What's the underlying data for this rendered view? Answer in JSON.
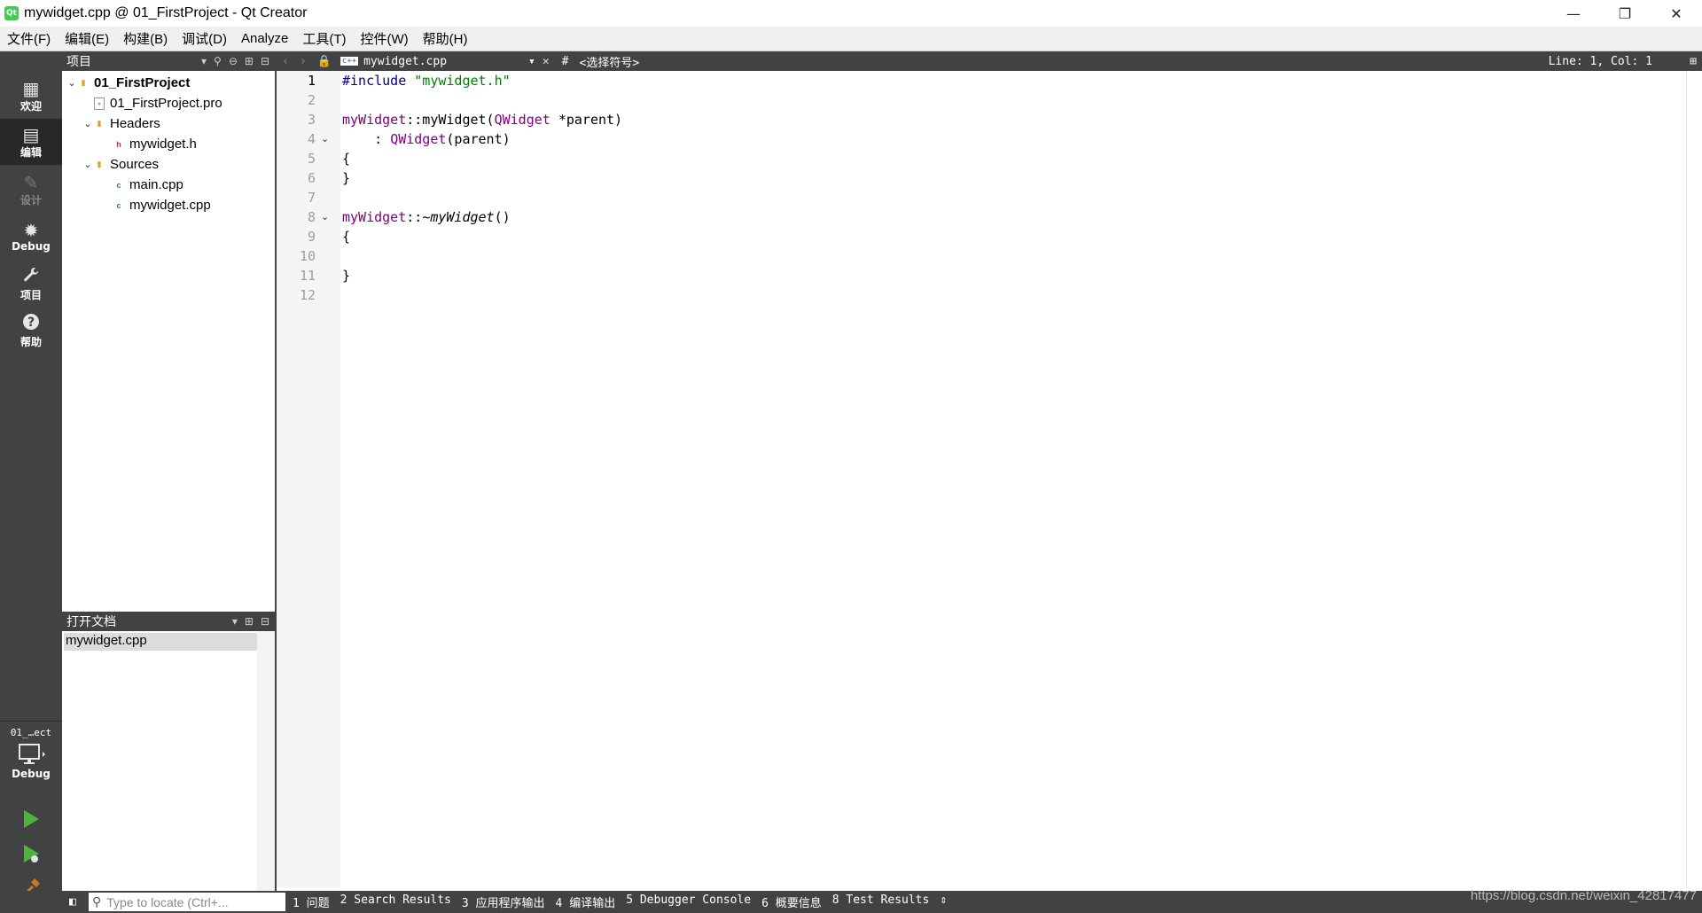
{
  "window": {
    "title": "mywidget.cpp @ 01_FirstProject - Qt Creator",
    "app_icon_text": "Qt",
    "minimize": "—",
    "maximize": "❐",
    "close": "✕"
  },
  "menu": [
    "文件(F)",
    "编辑(E)",
    "构建(B)",
    "调试(D)",
    "Analyze",
    "工具(T)",
    "控件(W)",
    "帮助(H)"
  ],
  "modes": [
    {
      "label": "欢迎",
      "icon": "grid-icon",
      "glyph": "▦",
      "state": "normal"
    },
    {
      "label": "编辑",
      "icon": "edit-icon",
      "glyph": "▤",
      "state": "active"
    },
    {
      "label": "设计",
      "icon": "pencil-icon",
      "glyph": "✎",
      "state": "disabled"
    },
    {
      "label": "Debug",
      "icon": "bug-icon",
      "glyph": "✹",
      "state": "normal"
    },
    {
      "label": "项目",
      "icon": "wrench-icon",
      "glyph": "🔧",
      "state": "normal"
    },
    {
      "label": "帮助",
      "icon": "help-icon",
      "glyph": "?",
      "state": "normal"
    }
  ],
  "kit": {
    "project": "01_…ect",
    "config": "Debug"
  },
  "project_panel": {
    "title": "项目",
    "tree": [
      {
        "label": "01_FirstProject",
        "level": 0,
        "expanded": true,
        "bold": true,
        "icon": "project-folder-icon"
      },
      {
        "label": "01_FirstProject.pro",
        "level": 1,
        "icon": "pro-file-icon"
      },
      {
        "label": "Headers",
        "level": 1,
        "expanded": true,
        "icon": "headers-folder-icon"
      },
      {
        "label": "mywidget.h",
        "level": 2,
        "icon": "header-file-icon"
      },
      {
        "label": "Sources",
        "level": 1,
        "expanded": true,
        "icon": "sources-folder-icon"
      },
      {
        "label": "main.cpp",
        "level": 2,
        "icon": "cpp-file-icon"
      },
      {
        "label": "mywidget.cpp",
        "level": 2,
        "icon": "cpp-file-icon"
      }
    ]
  },
  "open_docs": {
    "title": "打开文档",
    "items": [
      "mywidget.cpp"
    ]
  },
  "editor": {
    "filename": "mywidget.cpp",
    "symbol_hash": "#",
    "symbol": "<选择符号>",
    "position": "Line: 1, Col: 1",
    "line_numbers": [
      "1",
      "2",
      "3",
      "4",
      "5",
      "6",
      "7",
      "8",
      "9",
      "10",
      "11",
      "12"
    ]
  },
  "statusbar": {
    "locator_placeholder": "Type to locate (Ctrl+...",
    "tabs": [
      "1 问题",
      "2 Search Results",
      "3 应用程序输出",
      "4 编译输出",
      "5 Debugger Console",
      "6 概要信息",
      "8 Test Results"
    ]
  },
  "watermark": "https://blog.csdn.net/weixin_42817477",
  "colors": {
    "dark_panel": "#404244",
    "active_mode": "#262829",
    "string": "#008000",
    "class": "#800080",
    "preprocessor": "#000080"
  }
}
